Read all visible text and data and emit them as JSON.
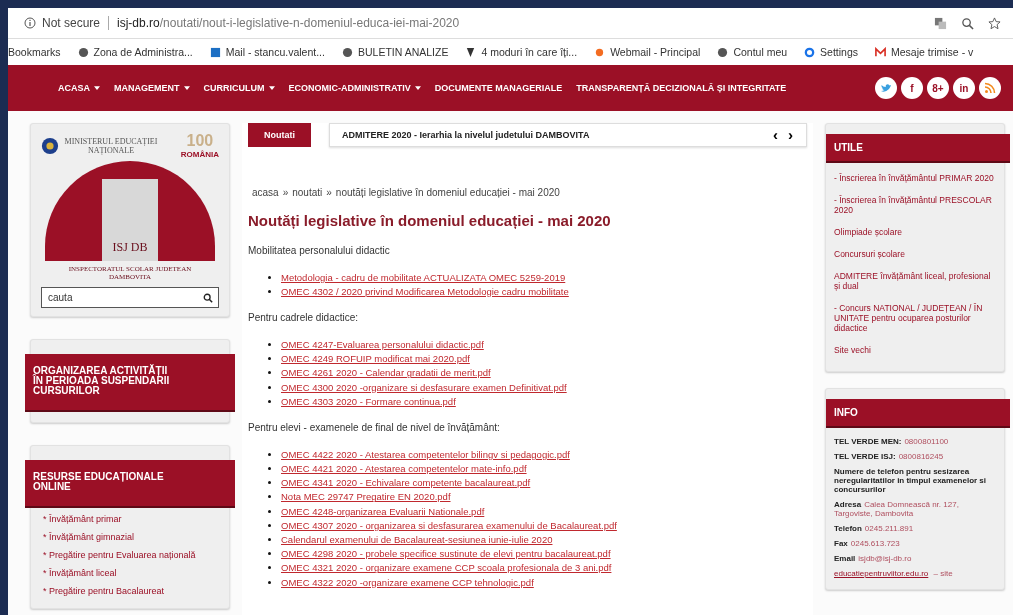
{
  "browser": {
    "security": "Not secure",
    "url_domain": "isj-db.ro",
    "url_path": "/noutati/nout-i-legislative-n-domeniul-educa-iei-mai-2020"
  },
  "bookmarks": {
    "label": "Bookmarks",
    "items": [
      {
        "kind": "globe",
        "label": "Zona de Administra..."
      },
      {
        "kind": "mail",
        "label": "Mail - stancu.valent..."
      },
      {
        "kind": "globe",
        "label": "BULETIN ANALIZE"
      },
      {
        "kind": "page",
        "label": "4 moduri în care îți..."
      },
      {
        "kind": "webmail",
        "label": "Webmail - Principal"
      },
      {
        "kind": "globe",
        "label": "Contul meu"
      },
      {
        "kind": "gear",
        "label": "Settings"
      },
      {
        "kind": "gmail",
        "label": "Mesaje trimise - v"
      }
    ]
  },
  "nav": [
    {
      "label": "ACASA",
      "has_dropdown": true
    },
    {
      "label": "MANAGEMENT",
      "has_dropdown": true
    },
    {
      "label": "CURRICULUM",
      "has_dropdown": true
    },
    {
      "label": "ECONOMIC-ADMINISTRATIV",
      "has_dropdown": true
    },
    {
      "label": "DOCUMENTE MANAGERIALE",
      "has_dropdown": false
    },
    {
      "label": "TRANSPARENȚĂ DECIZIONALĂ ȘI INTEGRITATE",
      "has_dropdown": false
    }
  ],
  "social": [
    {
      "kind": "twitter"
    },
    {
      "kind": "facebook",
      "label": "f"
    },
    {
      "kind": "googleplus",
      "label": "8+"
    },
    {
      "kind": "linkedin",
      "label": "in"
    },
    {
      "kind": "rss"
    }
  ],
  "logo": {
    "ministry": "MINISTERUL EDUCAȚIEI NAȚIONALE",
    "centenary": "100",
    "country": "ROMÂNIA",
    "acronym": "ISJ DB",
    "name": "INSPECTORATUL SCOLAR JUDETEAN DAMBOVITA"
  },
  "search": {
    "placeholder": "cauta"
  },
  "left_panels": [
    {
      "title": "ORGANIZAREA ACTIVITĂȚII ÎN PERIOADA SUSPENDARII CURSURILOR"
    },
    {
      "title": "RESURSE EDUCAȚIONALE ONLINE",
      "items": [
        "* Învățământ primar",
        "* Învățământ gimnazial",
        "* Pregătire pentru Evaluarea națională",
        "* Învățământ liceal",
        "* Pregătire pentru Bacalaureat"
      ]
    }
  ],
  "ticker": {
    "label": "Noutati",
    "text": "ADMITERE 2020 - Ierarhia la nivelul judetului DAMBOVITA",
    "prev": "‹",
    "next": "›"
  },
  "breadcrumb": {
    "separator": "»",
    "items": [
      "acasa",
      "noutati",
      "noutăți legislative în domeniul educației - mai 2020"
    ]
  },
  "title": "Noutăți legislative în domeniul educației - mai 2020",
  "sections": [
    {
      "heading": "Mobilitatea personalului didactic",
      "links": [
        "Metodologia - cadru de mobilitate ACTUALIZATA OMEC 5259-2019",
        "OMEC 4302 / 2020 privind Modificarea Metodologie cadru mobilitate"
      ]
    },
    {
      "heading": "Pentru cadrele didactice:",
      "links": [
        "OMEC 4247-Evaluarea personalului didactic.pdf",
        "OMEC 4249 ROFUIP modificat mai 2020.pdf",
        "OMEC 4261 2020 - Calendar gradatii de merit.pdf",
        "OMEC 4300 2020 -organizare si desfasurare examen Definitivat.pdf",
        "OMEC 4303 2020 - Formare continua.pdf"
      ]
    },
    {
      "heading": "Pentru elevi - examenele de final de nivel de învățământ:",
      "links": [
        "OMEC 4422 2020 - Atestarea competentelor bilingv si pedagogic.pdf",
        "OMEC 4421 2020 - Atestarea competentelor mate-info.pdf",
        "OMEC 4341 2020 - Echivalare competente bacalaureat.pdf",
        "Nota MEC 29747 Pregatire EN 2020.pdf",
        "OMEC 4248-organizarea Evaluarii Nationale.pdf",
        "OMEC 4307 2020 - organizarea si desfasurarea examenului de Bacalaureat.pdf",
        "Calendarul examenului de Bacalaureat-sesiunea iunie-iulie 2020",
        "OMEC 4298 2020 - probele specifice sustinute de elevi pentru bacalaureat.pdf",
        "OMEC 4321 2020 - organizare examene CCP scoala profesionala de 3 ani.pdf",
        "OMEC 4322 2020 -organizare examene CCP tehnologic.pdf"
      ]
    }
  ],
  "utile": {
    "title": "UTILE",
    "links": [
      "- Înscrierea în învățământul PRIMAR 2020",
      "- Înscrierea în învățământul PRESCOLAR 2020",
      "Olimpiade școlare",
      "Concursuri școlare",
      "ADMITERE învățământ liceal, profesional și dual",
      "- Concurs NATIONAL / JUDEȚEAN / ÎN UNITATE pentru ocuparea posturilor didactice",
      "Site vechi"
    ]
  },
  "info": {
    "title": "INFO",
    "rows": [
      {
        "label": "TEL VERDE MEN:",
        "value": "0800801100"
      },
      {
        "label": "TEL VERDE ISJ:",
        "value": "0800816245"
      },
      {
        "label": "Numere de telefon pentru sesizarea neregularitatilor in timpul examenelor si concursurilor"
      },
      {
        "label": "Adresa",
        "value": "Calea Domnească nr. 127, Targoviste, Dambovita"
      },
      {
        "label": "Telefon",
        "value": "0245.211.891"
      },
      {
        "label": "Fax",
        "value": "0245.613.723"
      },
      {
        "label": "Email",
        "value": "isjdb@isj-db.ro"
      }
    ],
    "footer_link": "educatiepentruviitor.edu.ro",
    "footer_text": "– site"
  }
}
